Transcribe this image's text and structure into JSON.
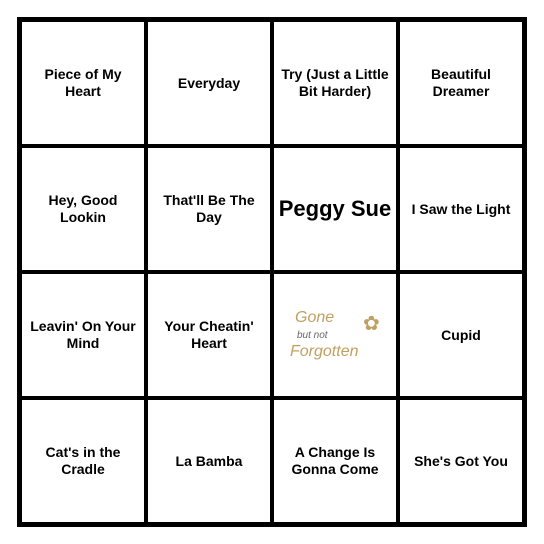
{
  "cells": [
    {
      "id": "r0c0",
      "text": "Piece of My Heart",
      "type": "normal"
    },
    {
      "id": "r0c1",
      "text": "Everyday",
      "type": "normal"
    },
    {
      "id": "r0c2",
      "text": "Try (Just a Little Bit Harder)",
      "type": "normal"
    },
    {
      "id": "r0c3",
      "text": "Beautiful Dreamer",
      "type": "normal"
    },
    {
      "id": "r1c0",
      "text": "Hey, Good Lookin",
      "type": "normal"
    },
    {
      "id": "r1c1",
      "text": "That'll Be The Day",
      "type": "normal"
    },
    {
      "id": "r1c2",
      "text": "Peggy Sue",
      "type": "peggy"
    },
    {
      "id": "r1c3",
      "text": "I Saw the Light",
      "type": "normal"
    },
    {
      "id": "r2c0",
      "text": "Leavin' On Your Mind",
      "type": "normal"
    },
    {
      "id": "r2c1",
      "text": "Your Cheatin' Heart",
      "type": "normal"
    },
    {
      "id": "r2c2",
      "text": "",
      "type": "gone"
    },
    {
      "id": "r2c3",
      "text": "Cupid",
      "type": "normal"
    },
    {
      "id": "r3c0",
      "text": "Cat's in the Cradle",
      "type": "normal"
    },
    {
      "id": "r3c1",
      "text": "La Bamba",
      "type": "normal"
    },
    {
      "id": "r3c2",
      "text": "A Change Is Gonna Come",
      "type": "normal"
    },
    {
      "id": "r3c3",
      "text": "She's Got You",
      "type": "normal"
    }
  ]
}
